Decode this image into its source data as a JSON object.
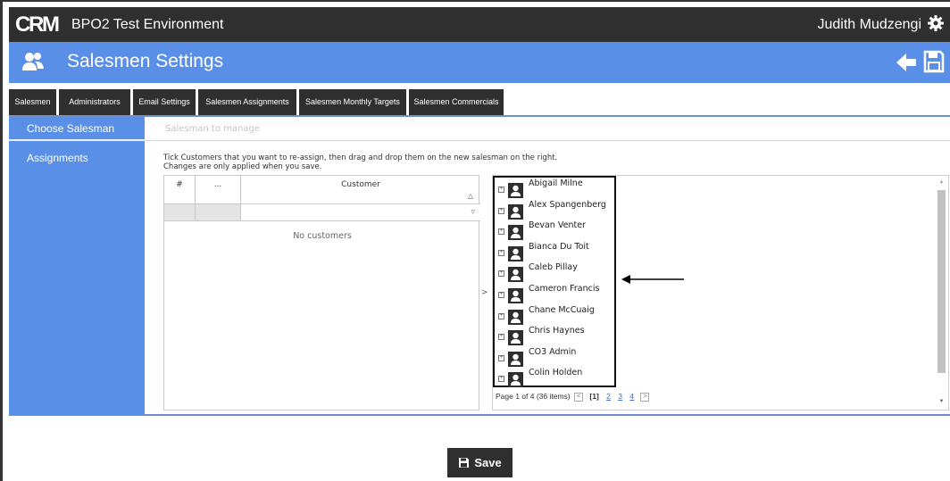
{
  "topbar": {
    "logo_text": "CRM",
    "app_title": "BPO2 Test Environment",
    "user_name": "Judith Mudzengi"
  },
  "header": {
    "page_title": "Salesmen Settings"
  },
  "tabs": [
    {
      "label": "Salesmen"
    },
    {
      "label": "Administrators"
    },
    {
      "label": "Email Settings"
    },
    {
      "label": "Salesmen Assignments"
    },
    {
      "label": "Salesmen Monthly Targets"
    },
    {
      "label": "Salesmen Commercials"
    }
  ],
  "sidebar": {
    "items": [
      {
        "label": "Choose Salesman"
      },
      {
        "label": "Assignments"
      }
    ]
  },
  "salesman_input": {
    "placeholder": "Salesman to manage"
  },
  "instructions": {
    "line1": "Tick Customers that you want to re-assign, then drag and drop them on the new salesman on the right.",
    "line2": "Changes are only applied when you save."
  },
  "grid": {
    "columns": [
      "#",
      "...",
      "Customer"
    ],
    "empty_text": "No customers"
  },
  "drop_arrow": ">",
  "salesmen": [
    {
      "name": "Abigail Milne"
    },
    {
      "name": "Alex Spangenberg"
    },
    {
      "name": "Bevan Venter"
    },
    {
      "name": "Bianca Du Toit"
    },
    {
      "name": "Caleb Pillay"
    },
    {
      "name": "Cameron Francis"
    },
    {
      "name": "Chane McCuaig"
    },
    {
      "name": "Chris Haynes"
    },
    {
      "name": "CO3 Admin"
    },
    {
      "name": "Colin Holden"
    }
  ],
  "pager": {
    "summary": "Page 1 of 4 (36 items)",
    "current": "[1]",
    "pages": [
      "2",
      "3",
      "4"
    ]
  },
  "footer": {
    "save_label": "Save"
  },
  "colors": {
    "dark_bar": "#2f2f2f",
    "accent_blue": "#5a8fe8"
  }
}
